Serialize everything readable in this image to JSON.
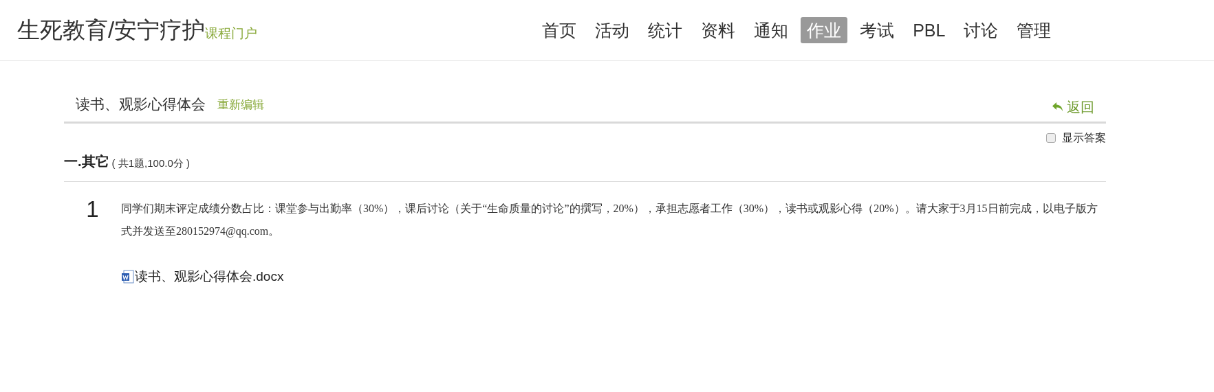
{
  "header": {
    "title": "生死教育/安宁疗护",
    "subtitle": "课程门户",
    "nav": [
      {
        "label": "首页",
        "selected": false
      },
      {
        "label": "活动",
        "selected": false
      },
      {
        "label": "统计",
        "selected": false
      },
      {
        "label": "资料",
        "selected": false
      },
      {
        "label": "通知",
        "selected": false
      },
      {
        "label": "作业",
        "selected": true
      },
      {
        "label": "考试",
        "selected": false
      },
      {
        "label": "PBL",
        "selected": false
      },
      {
        "label": "讨论",
        "selected": false
      },
      {
        "label": "管理",
        "selected": false
      }
    ]
  },
  "assignment": {
    "title": "读书、观影心得体会",
    "edit_link": "重新编辑",
    "back_link": "返回",
    "show_answers": {
      "label": "显示答案",
      "checked": false
    }
  },
  "section": {
    "heading": "一.其它",
    "summary": "( 共1题,100.0分 )"
  },
  "questions": [
    {
      "number": "1",
      "text": "同学们期末评定成绩分数占比：课堂参与出勤率（30%），课后讨论（关于“生命质量的讨论”的撰写，20%），承担志愿者工作（30%），读书或观影心得（20%）。请大家于3月15日前完成，以电子版方式并发送至280152974@qq.com。",
      "attachment": "读书、观影心得体会.docx"
    }
  ]
}
